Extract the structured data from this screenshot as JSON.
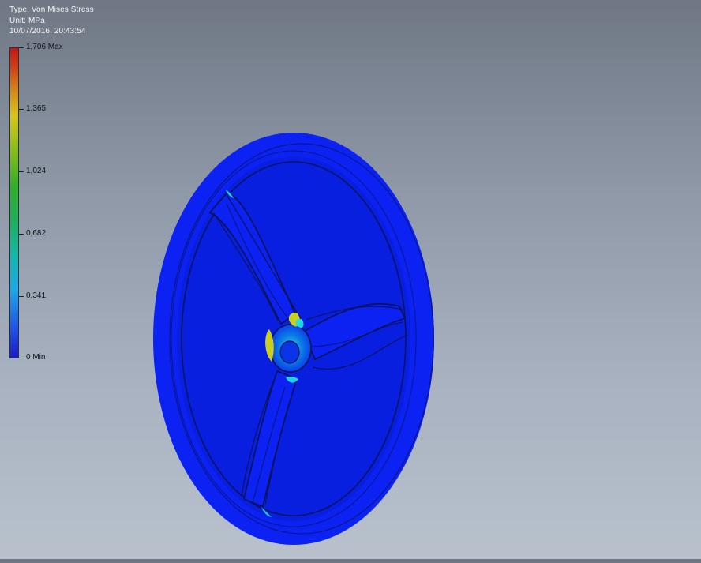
{
  "header": {
    "type_line": "Type: Von Mises Stress",
    "unit_line": "Unit: MPa",
    "timestamp": "10/07/2016, 20:43:54"
  },
  "legend": {
    "levels": [
      {
        "label": "1,706 Max",
        "value": 1.706
      },
      {
        "label": "1,365",
        "value": 1.365
      },
      {
        "label": "1,024",
        "value": 1.024
      },
      {
        "label": "0,682",
        "value": 0.682
      },
      {
        "label": "0,341",
        "value": 0.341
      },
      {
        "label": "0 Min",
        "value": 0
      }
    ],
    "colors": {
      "min": "#1a1acc",
      "low": "#1ca8e8",
      "mid": "#2fae2a",
      "high": "#d7c51a",
      "max": "#c81414"
    }
  },
  "model": {
    "main_color": "#0b22f2",
    "edge_color": "#0a1350",
    "hotspot_color": "#d6d818",
    "cyan_color": "#1ce0e7"
  }
}
